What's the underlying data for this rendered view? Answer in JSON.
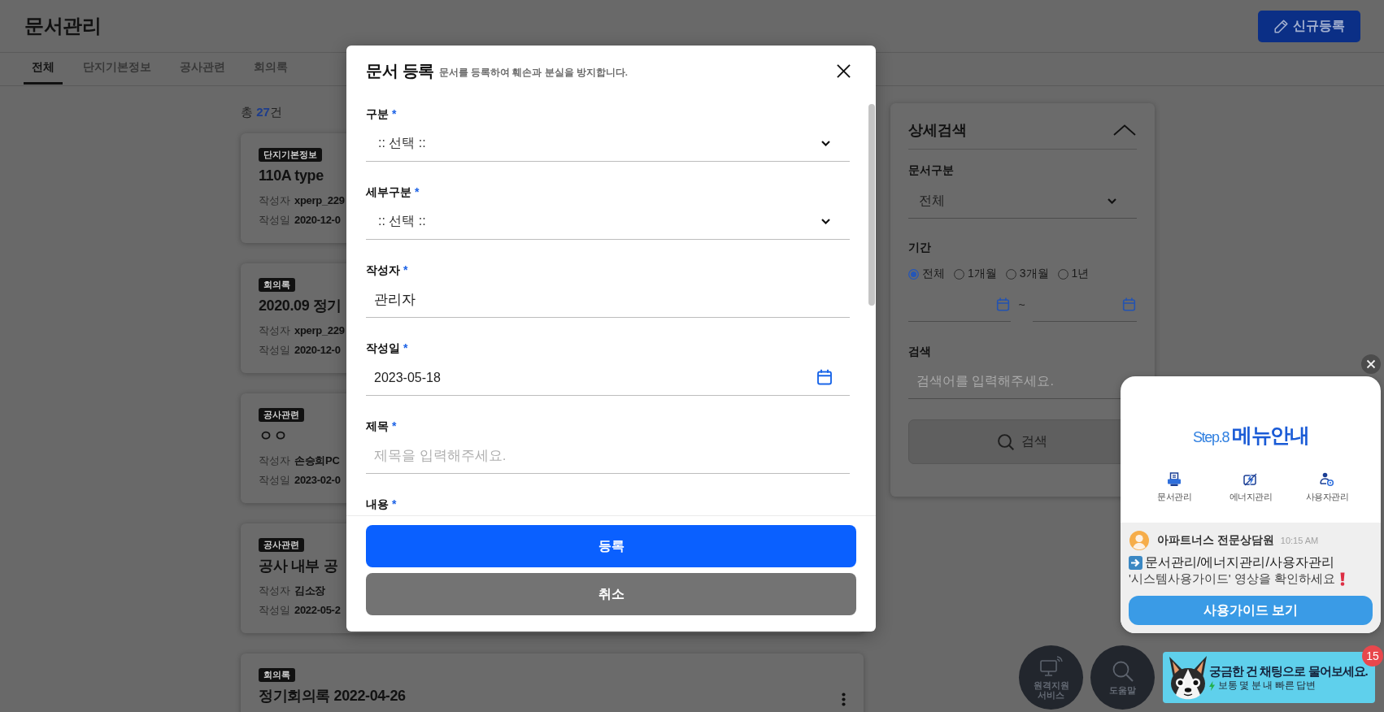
{
  "header": {
    "title": "문서관리",
    "new_button": "신규등록"
  },
  "tabs": [
    {
      "label": "전체",
      "selected": true
    },
    {
      "label": "단지기본정보",
      "selected": false
    },
    {
      "label": "공사관련",
      "selected": false
    },
    {
      "label": "회의록",
      "selected": false
    }
  ],
  "document_list": {
    "total": "총 **27**건",
    "cards": [
      {
        "tag": "단지기본정보",
        "title": "110A type",
        "author_label": "작성자",
        "author": "xperp_229",
        "date_label": "작성일",
        "date": "2020-12-0"
      },
      {
        "tag": "회의록",
        "title": "2020.09 정기",
        "author_label": "작성자",
        "author": "xperp_229",
        "date_label": "작성일",
        "date": "2020-12-0"
      },
      {
        "tag": "공사관련",
        "title": "ㅇㅇ",
        "author_label": "작성자",
        "author": "손승희PC",
        "date_label": "작성일",
        "date": "2023-02-0"
      },
      {
        "tag": "공사관련",
        "title": "공사 내부 공",
        "author_label": "작성자",
        "author": "김소장",
        "date_label": "작성일",
        "date": "2022-05-2"
      },
      {
        "tag": "회의록",
        "title": "정기회의록 2022-04-26",
        "menu": true
      }
    ]
  },
  "detail_search": {
    "title": "상세검색",
    "expanded": true,
    "doc_type_label": "문서구분",
    "doc_type_value": "전체",
    "period_label": "기간",
    "period_options": [
      {
        "label": "전체",
        "selected": true
      },
      {
        "label": "1개월",
        "selected": false
      },
      {
        "label": "3개월",
        "selected": false
      },
      {
        "label": "1년",
        "selected": false
      }
    ],
    "range_separator": "~",
    "search_label": "검색",
    "search_placeholder": "검색어를 입력해주세요.",
    "search_button": "검색"
  },
  "register_modal": {
    "title": "문서 등록",
    "subtitle": "문서를 등록하여 훼손과 분실을 방지합니다.",
    "fields": [
      {
        "kind": "select",
        "label": "구분",
        "required_mark": "*",
        "value": ":: 선택 ::"
      },
      {
        "kind": "select",
        "label": "세부구분",
        "required_mark": "*",
        "value": ":: 선택 ::"
      },
      {
        "kind": "text",
        "label": "작성자",
        "required_mark": "*",
        "value": "관리자"
      },
      {
        "kind": "date",
        "label": "작성일",
        "required_mark": "*",
        "value": "2023-05-18"
      },
      {
        "kind": "text",
        "label": "제목",
        "required_mark": "*",
        "placeholder": "제목을 입력해주세요."
      },
      {
        "kind": "label",
        "label": "내용",
        "required_mark": "*"
      }
    ],
    "buttons": [
      {
        "kind": "primary",
        "label": "등록"
      },
      {
        "kind": "secondary",
        "label": "취소"
      }
    ]
  },
  "guide_popup": {
    "step": "Step.8",
    "heading": "메뉴안내",
    "menu_items": [
      {
        "kind": "document",
        "label": "문서관리"
      },
      {
        "kind": "energy",
        "label": "에너지관리"
      },
      {
        "kind": "user",
        "label": "사용자관리"
      }
    ],
    "sender": "아파트너스 전문상담원",
    "time": "10:15 AM",
    "message": [
      {
        "kind": "arrow",
        "text": "문서관리/에너지관리/사용자관리"
      },
      {
        "kind": "alert",
        "text": "'시스템사용가이드' 영상을 확인하세요"
      }
    ],
    "button": "사용가이드 보기"
  },
  "floating_buttons": [
    {
      "kind": "remote",
      "label": "원격지원 서비스"
    },
    {
      "kind": "help",
      "label": "도움말"
    }
  ],
  "chat_banner": {
    "title": "궁금한 건 채팅으로 물어보세요.",
    "subtitle": "보통 몇 분 내 빠른 답변",
    "badge": "15"
  }
}
